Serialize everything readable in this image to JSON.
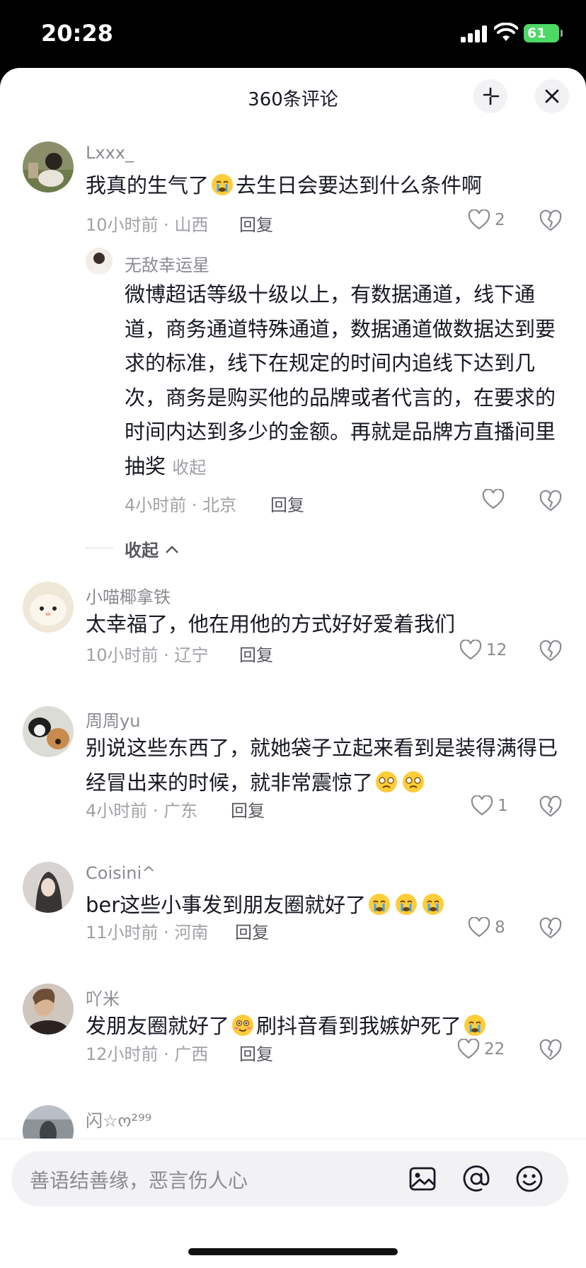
{
  "status_bar": {
    "time": "20:28",
    "battery": "61"
  },
  "header": {
    "title": "360条评论"
  },
  "comments": [
    {
      "user": "Lxxx_",
      "text_before": "我真的生气了",
      "text_after": "去生日会要达到什么条件啊",
      "meta": "10小时前 · 山西",
      "reply": "回复",
      "likes": "2"
    },
    {
      "user": "无敌幸运星",
      "text": "微博超话等级十级以上，有数据通道，线下通道，商务通道特殊通道，数据通道做数据达到要求的标准，线下在规定的时间内追线下达到几次，商务是购买他的品牌或者代言的，在要求的时间内达到多少的金额。再就是品牌方直播间里抽奖",
      "collapse": "收起",
      "meta": "4小时前 · 北京",
      "reply": "回复"
    },
    {
      "user": "小喵椰拿铁",
      "text": "太幸福了，他在用他的方式好好爱着我们",
      "meta": "10小时前 · 辽宁",
      "reply": "回复",
      "likes": "12"
    },
    {
      "user": "周周yu",
      "text": "别说这些东西了，就她袋子立起来看到是装得满得已经冒出来的时候，就非常震惊了",
      "meta": "4小时前 · 广东",
      "reply": "回复",
      "likes": "1"
    },
    {
      "user": "Coisini^",
      "text": "ber这些小事发到朋友圈就好了",
      "meta": "11小时前 · 河南",
      "reply": "回复",
      "likes": "8"
    },
    {
      "user": "吖米",
      "text_before": "发朋友圈就好了",
      "text_after": "刷抖音看到我嫉妒死了",
      "meta": "12小时前 · 广西",
      "reply": "回复",
      "likes": "22"
    },
    {
      "user": "闪☆ო²⁹⁹"
    }
  ],
  "fold": {
    "label": "收起"
  },
  "input": {
    "placeholder": "善语结善缘，恶言伤人心"
  },
  "colors": {
    "text": "#161823",
    "secondary": "#8a8b91",
    "battery": "#4cd964"
  },
  "icons": [
    "shrink-icon",
    "close-icon",
    "heart-icon",
    "dislike-icon",
    "image-icon",
    "at-icon",
    "emoji-icon",
    "crying-emoji-icon",
    "teary-emoji-icon",
    "shy-emoji-icon"
  ]
}
